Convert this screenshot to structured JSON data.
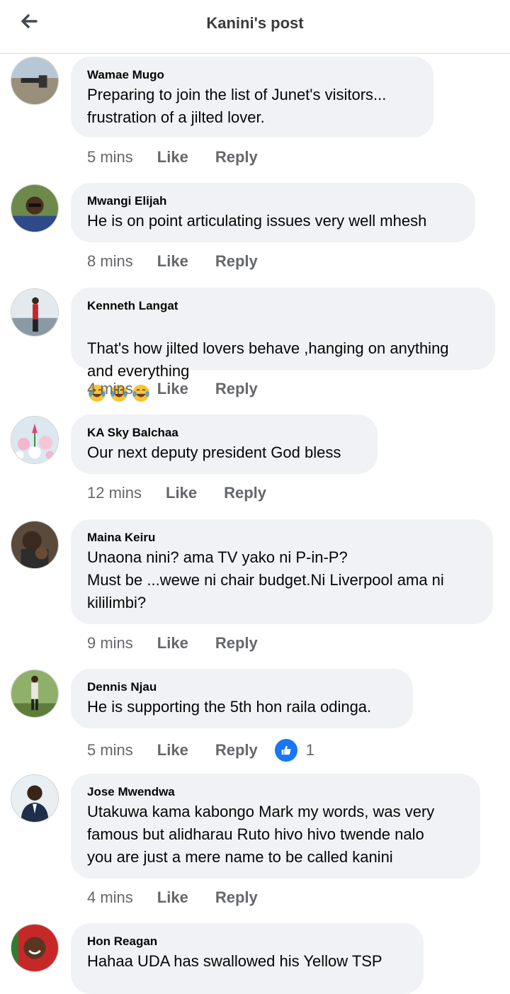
{
  "header": {
    "title": "Kanini's post"
  },
  "comments": [
    {
      "name": "Wamae Mugo",
      "text": "Preparing to join the list of Junet's visitors...\nfrustration of a jilted lover.",
      "time": "5 mins",
      "like": "Like",
      "reply": "Reply"
    },
    {
      "name": "Mwangi Elijah",
      "text": "He is on point articulating issues very well mhesh",
      "time": "8 mins",
      "like": "Like",
      "reply": "Reply"
    },
    {
      "name": "Kenneth Langat",
      "text": "That's how jilted lovers behave ,hanging on anything\nand everything",
      "time": "4 mins",
      "like": "Like",
      "reply": "Reply",
      "emojis": [
        "tears-of-joy-emoji",
        "tears-of-joy-emoji",
        "tears-of-joy-emoji"
      ]
    },
    {
      "name": "KA Sky Balchaa",
      "text": "Our next deputy president God bless",
      "time": "12 mins",
      "like": "Like",
      "reply": "Reply"
    },
    {
      "name": "Maina Keiru",
      "text": "Unaona nini? ama TV yako ni P-in-P?\nMust be ...wewe ni chair budget.Ni Liverpool ama ni\nkililimbi?",
      "time": "9 mins",
      "like": "Like",
      "reply": "Reply"
    },
    {
      "name": "Dennis Njau",
      "text": "He is supporting the 5th hon raila odinga.",
      "time": "5 mins",
      "like": "Like",
      "reply": "Reply",
      "reaction_count": "1",
      "reaction_icon": "thumbs-up-icon"
    },
    {
      "name": "Jose Mwendwa",
      "text": "Utakuwa kama kabongo Mark my words, was very\nfamous but alidharau Ruto hivo hivo twende nalo\nyou are just a mere name to be called kanini",
      "time": "4 mins",
      "like": "Like",
      "reply": "Reply"
    },
    {
      "name": "Hon Reagan",
      "text": "Hahaa UDA has swallowed his Yellow TSP",
      "time": "",
      "like": "",
      "reply": ""
    }
  ],
  "colors": {
    "bubble": "#f0f2f5",
    "meta": "#65676b",
    "like_blue": "#1877f2"
  }
}
